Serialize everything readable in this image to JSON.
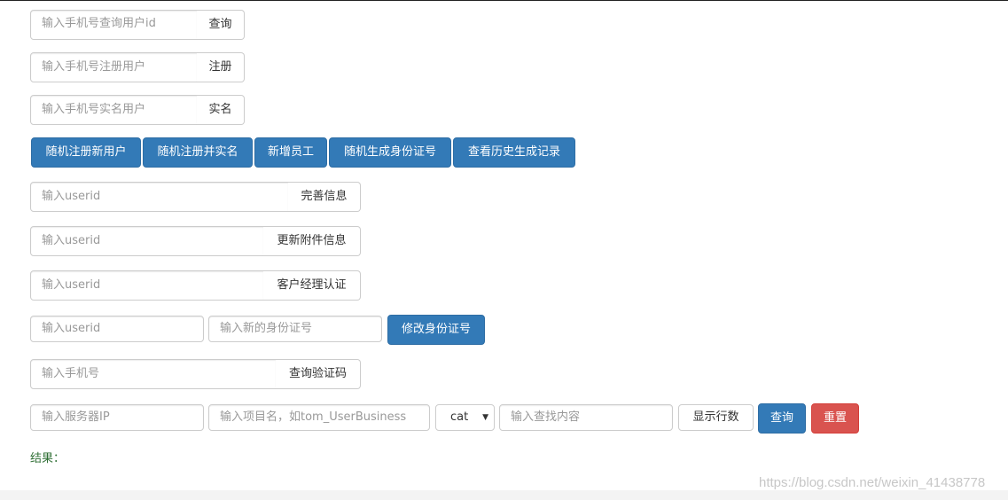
{
  "query_user": {
    "placeholder": "输入手机号查询用户id",
    "button": "查询"
  },
  "register_user": {
    "placeholder": "输入手机号注册用户",
    "button": "注册"
  },
  "realname_user": {
    "placeholder": "输入手机号实名用户",
    "button": "实名"
  },
  "action_buttons": [
    "随机注册新用户",
    "随机注册并实名",
    "新增员工",
    "随机生成身份证号",
    "查看历史生成记录"
  ],
  "complete_info": {
    "placeholder": "输入userid",
    "button": "完善信息"
  },
  "update_attachment": {
    "placeholder": "输入userid",
    "button": "更新附件信息"
  },
  "manager_cert": {
    "placeholder": "输入userid",
    "button": "客户经理认证"
  },
  "modify_id": {
    "userid_placeholder": "输入userid",
    "id_placeholder": "输入新的身份证号",
    "button": "修改身份证号"
  },
  "verify_code": {
    "placeholder": "输入手机号",
    "button": "查询验证码"
  },
  "log_search": {
    "ip_placeholder": "输入服务器IP",
    "project_placeholder": "输入项目名，如tom_UserBusiness",
    "select_value": "cat",
    "content_placeholder": "输入查找内容",
    "rows_button": "显示行数",
    "query_button": "查询",
    "reset_button": "重置"
  },
  "result_label": "结果：",
  "watermark": "https://blog.csdn.net/weixin_41438778",
  "colors": {
    "primary": "#337ab7",
    "danger": "#d9534f",
    "result_text": "#2f6f35"
  }
}
